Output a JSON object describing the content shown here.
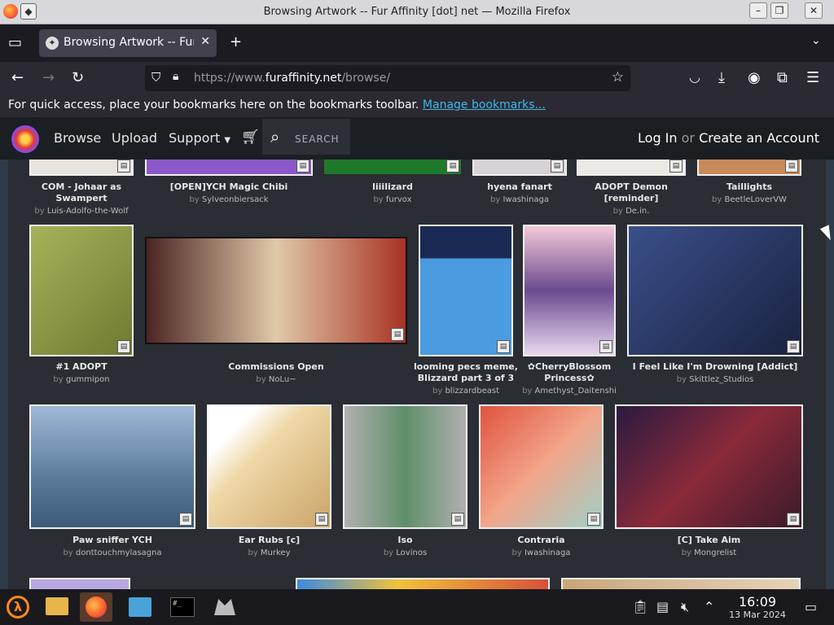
{
  "window": {
    "title": "Browsing Artwork -- Fur Affinity [dot] net — Mozilla Firefox"
  },
  "tab": {
    "label": "Browsing Artwork -- Fur A"
  },
  "urlbar": {
    "prefix": "https://www.",
    "domain": "furaffinity.net",
    "path": "/browse/"
  },
  "bookmarks": {
    "text": "For quick access, place your bookmarks here on the bookmarks toolbar.",
    "link": "Manage bookmarks..."
  },
  "site": {
    "nav": {
      "browse": "Browse",
      "upload": "Upload",
      "support": "Support",
      "search": "SEARCH"
    },
    "login": {
      "login": "Log In",
      "or": "or",
      "create": "Create an Account"
    },
    "by_label": "by"
  },
  "gallery": [
    {
      "title": "COM - Johaar as Swampert",
      "artist": "Luis-Adolfo-the-Wolf",
      "color": "#e8e3dc"
    },
    {
      "title": "[OPEN]YCH Magic Chibi",
      "artist": "Sylveonbiersack",
      "color": "#8a58c9"
    },
    {
      "title": "liiilizard",
      "artist": "furvox",
      "color": "#1f7a2b"
    },
    {
      "title": "hyena fanart",
      "artist": "Iwashinaga",
      "color": "#d8d2d6"
    },
    {
      "title": "ADOPT Demon [reminder]",
      "artist": "De.in.",
      "color": "#ece8e4"
    },
    {
      "title": "Taillights",
      "artist": "BeetleLoverVW",
      "color": "#c98a5a"
    },
    {
      "title": "#1 ADOPT",
      "artist": "gummipon",
      "color": "#8d9a45"
    },
    {
      "title": "Commissions Open",
      "artist": "NoLu~",
      "color": "#6a2a28"
    },
    {
      "title": "looming pecs meme, Blizzard part 3 of 3",
      "artist": "blizzardbeast",
      "color": "#4a9be0"
    },
    {
      "title": "✿CherryBlossom Princess✿",
      "artist": "Amethyst_Daitenshi",
      "color": "#c9a3d8"
    },
    {
      "title": "I Feel Like I'm Drowning [Addict]",
      "artist": "Skittlez_Studios",
      "color": "#2e3e6a"
    },
    {
      "title": "Paw sniffer YCH",
      "artist": "donttouchmylasagna",
      "color": "#6c8fb8"
    },
    {
      "title": "Ear Rubs [c]",
      "artist": "Murkey",
      "color": "#efd8a8"
    },
    {
      "title": "Iso",
      "artist": "Lovinos",
      "color": "#b9b9b9"
    },
    {
      "title": "Contraria",
      "artist": "Iwashinaga",
      "color": "#d95a45"
    },
    {
      "title": "[C] Take Aim",
      "artist": "Mongrelist",
      "color": "#6b2a4a"
    }
  ],
  "taskbar": {
    "time": "16:09",
    "date": "13 Mar 2024"
  },
  "colors": {
    "accent": "#3fb8e8",
    "tab_bg": "#42414d",
    "site_bar": "#1b1e23"
  }
}
